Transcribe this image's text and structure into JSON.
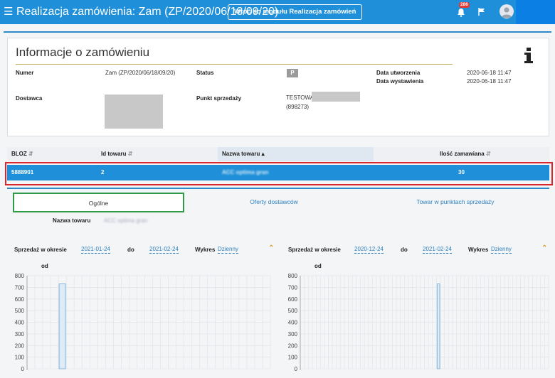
{
  "header": {
    "menu_icon": "hamburger-menu-icon",
    "title": "Realizacja zamówienia: Zam (ZP/2020/06/18/09/20)",
    "back_button": "Wróć do modułu Realizacja zamówień",
    "notifications_count": "286",
    "colors": {
      "bar": "#1e8fd8",
      "user_box": "#0b7fe4"
    }
  },
  "info": {
    "title": "Informacje o zamówieniu",
    "fields": {
      "numer_label": "Numer",
      "numer_value": "Zam (ZP/2020/06/18/09/20)",
      "status_label": "Status",
      "status_value": "P",
      "created_label": "Data utworzenia",
      "created_value": "2020-06-18 11:47",
      "issued_label": "Data wystawienia",
      "issued_value": "2020-06-18 11:47",
      "supplier_label": "Dostawca",
      "pos_label": "Punkt sprzedaży",
      "pos_value_line1": "TESTOWA",
      "pos_value_line2": "(898273)"
    }
  },
  "table": {
    "columns": [
      "BLOZ",
      "Id towaru",
      "Nazwa towaru",
      "Ilość zamawiana"
    ],
    "sorted_column": "Nazwa towaru",
    "row": {
      "bloz": "5888901",
      "id": "2",
      "name": "ACC optima gran",
      "qty": "30"
    }
  },
  "tabs": [
    "Ogólne",
    "Oferty dostawców",
    "Towar w punktach sprzedaży"
  ],
  "detail": {
    "name_label": "Nazwa towaru",
    "name_value": "ACC optima gran"
  },
  "sales_left": {
    "period_label": "Sprzedaż w okresie",
    "from": "2021-01-24",
    "to_label": "do",
    "to": "2021-02-24",
    "chart_label": "Wykres",
    "chart_mode": "Dzienny"
  },
  "sales_right": {
    "period_label": "Sprzedaż w okresie",
    "from": "2020-12-24",
    "to_label": "do",
    "to": "2021-02-24",
    "chart_label": "Wykres",
    "chart_mode": "Dzienny"
  },
  "chart_data": [
    {
      "type": "bar",
      "title": "",
      "legend": [
        "od"
      ],
      "ylim": [
        0,
        800
      ],
      "yticks": [
        0,
        100,
        200,
        300,
        400,
        500,
        600,
        700,
        800
      ],
      "grid": true,
      "n_days": 31,
      "values": [
        0,
        0,
        0,
        0,
        0,
        0,
        0,
        0,
        0,
        0,
        0,
        0,
        0,
        0,
        0,
        0,
        0,
        0,
        0,
        0,
        0,
        0,
        0,
        0,
        0,
        0,
        0,
        0,
        0,
        0,
        0
      ],
      "highlight_index": 4,
      "highlight_value": 730
    },
    {
      "type": "bar",
      "title": "",
      "legend": [
        "od"
      ],
      "ylim": [
        0,
        800
      ],
      "yticks": [
        0,
        100,
        200,
        300,
        400,
        500,
        600,
        700,
        800
      ],
      "grid": true,
      "n_days": 62,
      "highlight_index": 34,
      "highlight_value": 730
    }
  ]
}
